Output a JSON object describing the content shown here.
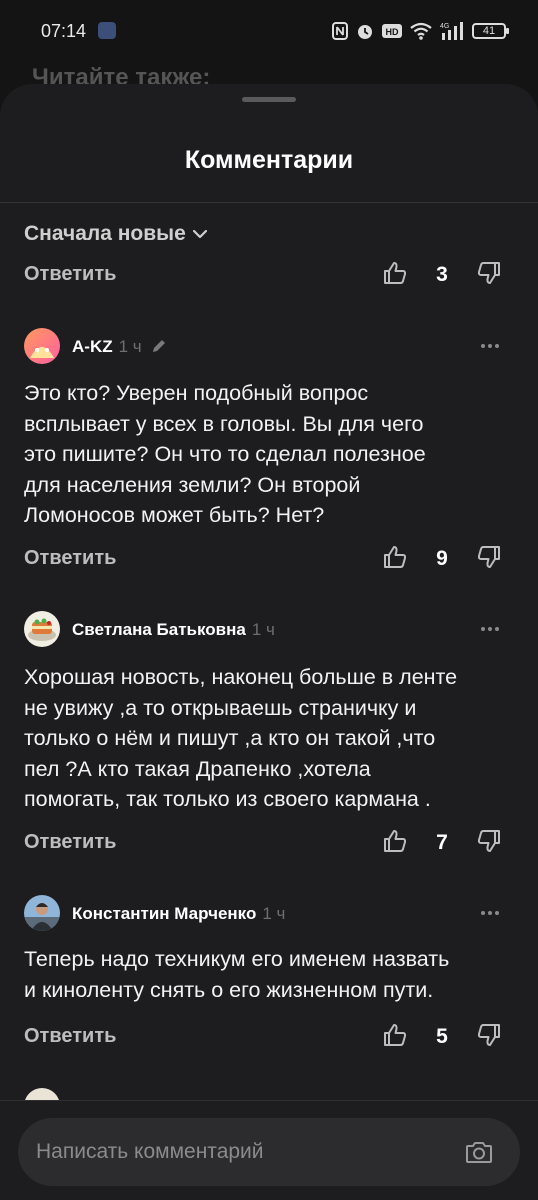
{
  "status_bar": {
    "time": "07:14",
    "battery": "41"
  },
  "background": {
    "heading": "Читайте также:"
  },
  "sheet": {
    "title": "Комментарии",
    "sort_label": "Сначала новые"
  },
  "top_action": {
    "reply_label": "Ответить",
    "likes": "3"
  },
  "comments": [
    {
      "author": "A-KZ",
      "time": "1 ч",
      "edited": true,
      "text_lines": [
        "Это кто? Уверен подобный вопрос",
        "всплывает у всех в головы. Вы для чего",
        "это пишите? Он что то сделал полезное",
        "для населения земли? Он второй",
        "Ломоносов может быть? Нет?"
      ],
      "reply_label": "Ответить",
      "likes": "9"
    },
    {
      "author": "Светлана Батьковна",
      "time": "1 ч",
      "edited": false,
      "text_lines": [
        "Хорошая новость, наконец больше в ленте",
        "не увижу ,а то открываешь  страничку и",
        "только  о нём и пишут ,а кто он такой ,что",
        "пел ?А кто такая Драпенко ,хотела",
        "помогать, так только  из своего кармана ."
      ],
      "reply_label": "Ответить",
      "likes": "7"
    },
    {
      "author": "Константин Марченко",
      "time": "1 ч",
      "edited": false,
      "text_lines": [
        "Теперь надо техникум его именем назвать",
        "и киноленту снять о его жизненном пути."
      ],
      "reply_label": "Ответить",
      "likes": "5"
    }
  ],
  "composer": {
    "placeholder": "Написать комментарий"
  },
  "icons": {
    "like": "thumbs-up-icon",
    "dislike": "thumbs-down-icon",
    "more": "more-dots-icon",
    "edit": "pencil-icon",
    "camera": "camera-icon",
    "sort": "chevron-down-icon"
  }
}
